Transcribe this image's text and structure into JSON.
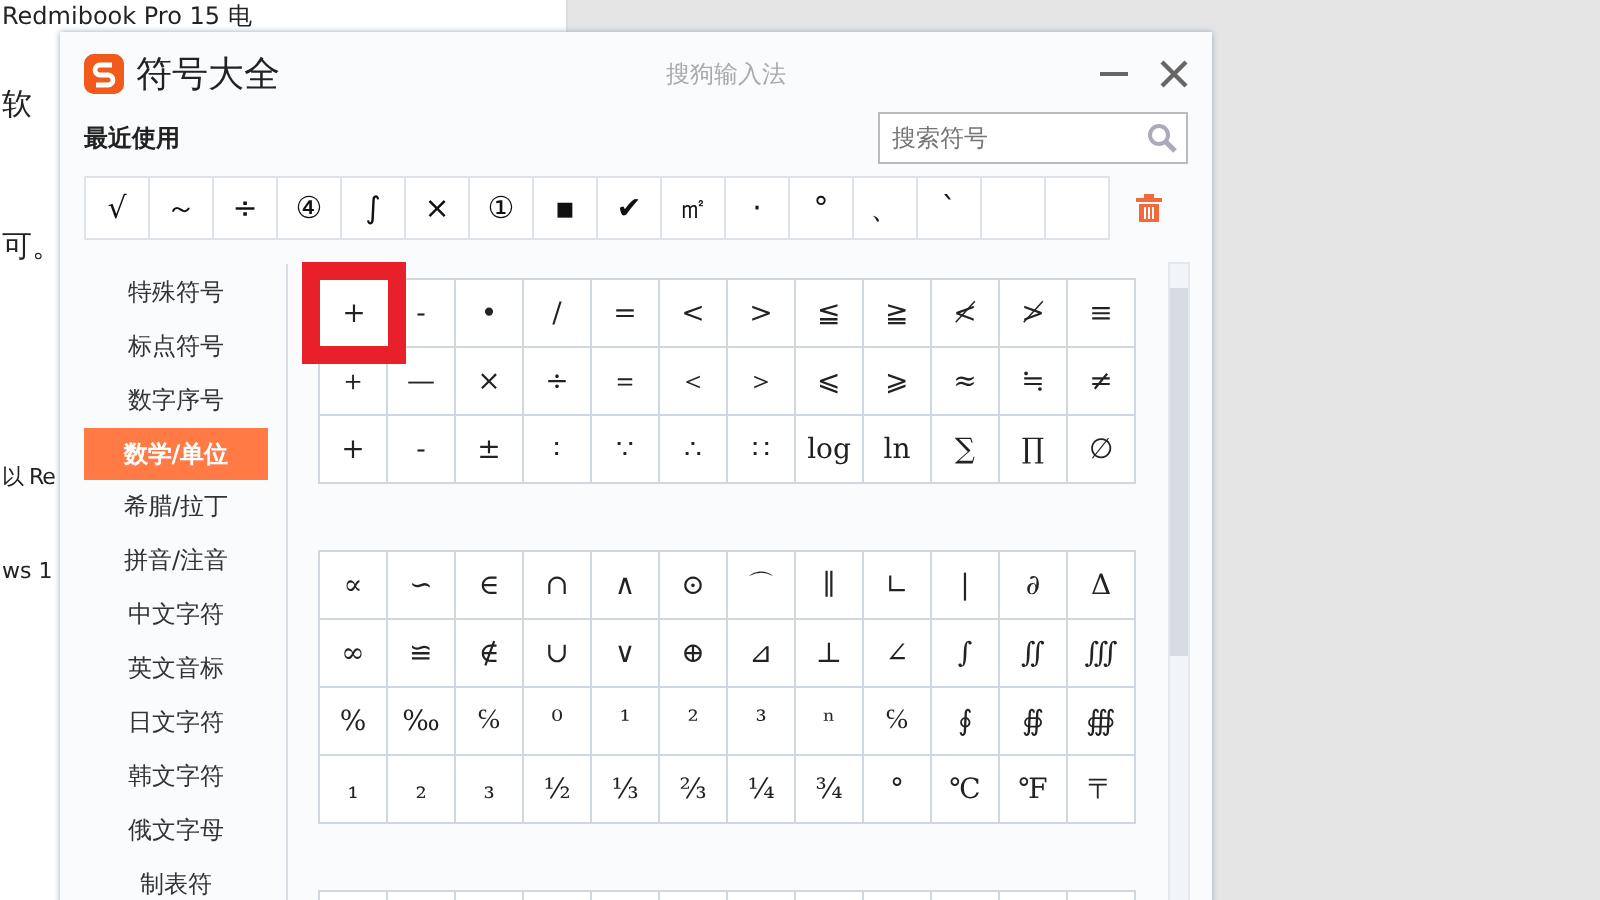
{
  "document": {
    "lines": [
      "Redmibook Pro 15 电",
      "软",
      "可。",
      "以 Re",
      "ws 1"
    ]
  },
  "window": {
    "title": "符号大全",
    "app_name": "搜狗输入法"
  },
  "recent": {
    "label": "最近使用",
    "symbols": [
      "√",
      "～",
      "÷",
      "④",
      "∫",
      "×",
      "①",
      "▪",
      "✔",
      "㎡",
      "·",
      "°",
      "、",
      "ˋ"
    ]
  },
  "search": {
    "placeholder": "搜索符号"
  },
  "sidebar": {
    "items": [
      {
        "label": "特殊符号",
        "selected": false
      },
      {
        "label": "标点符号",
        "selected": false
      },
      {
        "label": "数字序号",
        "selected": false
      },
      {
        "label": "数学/单位",
        "selected": true
      },
      {
        "label": "希腊/拉丁",
        "selected": false
      },
      {
        "label": "拼音/注音",
        "selected": false
      },
      {
        "label": "中文字符",
        "selected": false
      },
      {
        "label": "英文音标",
        "selected": false
      },
      {
        "label": "日文字符",
        "selected": false
      },
      {
        "label": "韩文字符",
        "selected": false
      },
      {
        "label": "俄文字母",
        "selected": false
      },
      {
        "label": "制表符",
        "selected": false
      }
    ]
  },
  "sections": [
    {
      "cells": [
        {
          "symbol": "+",
          "selected": true
        },
        {
          "symbol": "-",
          "selected": false
        },
        {
          "symbol": "•",
          "selected": false
        },
        {
          "symbol": "/",
          "selected": false
        },
        {
          "symbol": "=",
          "selected": false
        },
        {
          "symbol": "<",
          "selected": false
        },
        {
          "symbol": ">",
          "selected": false
        },
        {
          "symbol": "≦",
          "selected": false
        },
        {
          "symbol": "≧",
          "selected": false
        },
        {
          "symbol": "≮",
          "selected": false
        },
        {
          "symbol": "≯",
          "selected": false
        },
        {
          "symbol": "≡",
          "selected": false
        },
        {
          "symbol": "＋",
          "selected": false
        },
        {
          "symbol": "—",
          "selected": false
        },
        {
          "symbol": "×",
          "selected": false
        },
        {
          "symbol": "÷",
          "selected": false
        },
        {
          "symbol": "＝",
          "selected": false
        },
        {
          "symbol": "＜",
          "selected": false
        },
        {
          "symbol": "＞",
          "selected": false
        },
        {
          "symbol": "⩽",
          "selected": false
        },
        {
          "symbol": "⩾",
          "selected": false
        },
        {
          "symbol": "≈",
          "selected": false
        },
        {
          "symbol": "≒",
          "selected": false
        },
        {
          "symbol": "≠",
          "selected": false
        },
        {
          "symbol": "+",
          "selected": false
        },
        {
          "symbol": "-",
          "selected": false
        },
        {
          "symbol": "±",
          "selected": false
        },
        {
          "symbol": "∶",
          "selected": false
        },
        {
          "symbol": "∵",
          "selected": false
        },
        {
          "symbol": "∴",
          "selected": false
        },
        {
          "symbol": "∷",
          "selected": false
        },
        {
          "symbol": "log",
          "selected": false
        },
        {
          "symbol": "ln",
          "selected": false
        },
        {
          "symbol": "∑",
          "selected": false
        },
        {
          "symbol": "∏",
          "selected": false
        },
        {
          "symbol": "∅",
          "selected": false
        }
      ]
    },
    {
      "cells": [
        {
          "symbol": "∝",
          "selected": false
        },
        {
          "symbol": "∽",
          "selected": false
        },
        {
          "symbol": "∈",
          "selected": false
        },
        {
          "symbol": "∩",
          "selected": false
        },
        {
          "symbol": "∧",
          "selected": false
        },
        {
          "symbol": "⊙",
          "selected": false
        },
        {
          "symbol": "⌒",
          "selected": false
        },
        {
          "symbol": "∥",
          "selected": false
        },
        {
          "symbol": "∟",
          "selected": false
        },
        {
          "symbol": "|",
          "selected": false
        },
        {
          "symbol": "∂",
          "selected": false
        },
        {
          "symbol": "Δ",
          "selected": false
        },
        {
          "symbol": "∞",
          "selected": false
        },
        {
          "symbol": "≌",
          "selected": false
        },
        {
          "symbol": "∉",
          "selected": false
        },
        {
          "symbol": "∪",
          "selected": false
        },
        {
          "symbol": "∨",
          "selected": false
        },
        {
          "symbol": "⊕",
          "selected": false
        },
        {
          "symbol": "⊿",
          "selected": false
        },
        {
          "symbol": "⊥",
          "selected": false
        },
        {
          "symbol": "∠",
          "selected": false
        },
        {
          "symbol": "∫",
          "selected": false
        },
        {
          "symbol": "∬",
          "selected": false
        },
        {
          "symbol": "∭",
          "selected": false
        },
        {
          "symbol": "%",
          "selected": false
        },
        {
          "symbol": "‰",
          "selected": false
        },
        {
          "symbol": "℅",
          "selected": false
        },
        {
          "symbol": "⁰",
          "selected": false
        },
        {
          "symbol": "¹",
          "selected": false
        },
        {
          "symbol": "²",
          "selected": false
        },
        {
          "symbol": "³",
          "selected": false
        },
        {
          "symbol": "ⁿ",
          "selected": false
        },
        {
          "symbol": "℅",
          "selected": false
        },
        {
          "symbol": "∮",
          "selected": false
        },
        {
          "symbol": "∯",
          "selected": false
        },
        {
          "symbol": "∰",
          "selected": false
        },
        {
          "symbol": "₁",
          "selected": false
        },
        {
          "symbol": "₂",
          "selected": false
        },
        {
          "symbol": "₃",
          "selected": false
        },
        {
          "symbol": "½",
          "selected": false
        },
        {
          "symbol": "⅓",
          "selected": false
        },
        {
          "symbol": "⅔",
          "selected": false
        },
        {
          "symbol": "¼",
          "selected": false
        },
        {
          "symbol": "¾",
          "selected": false
        },
        {
          "symbol": "°",
          "selected": false
        },
        {
          "symbol": "℃",
          "selected": false
        },
        {
          "symbol": "℉",
          "selected": false
        },
        {
          "symbol": "〒",
          "selected": false
        }
      ]
    }
  ]
}
